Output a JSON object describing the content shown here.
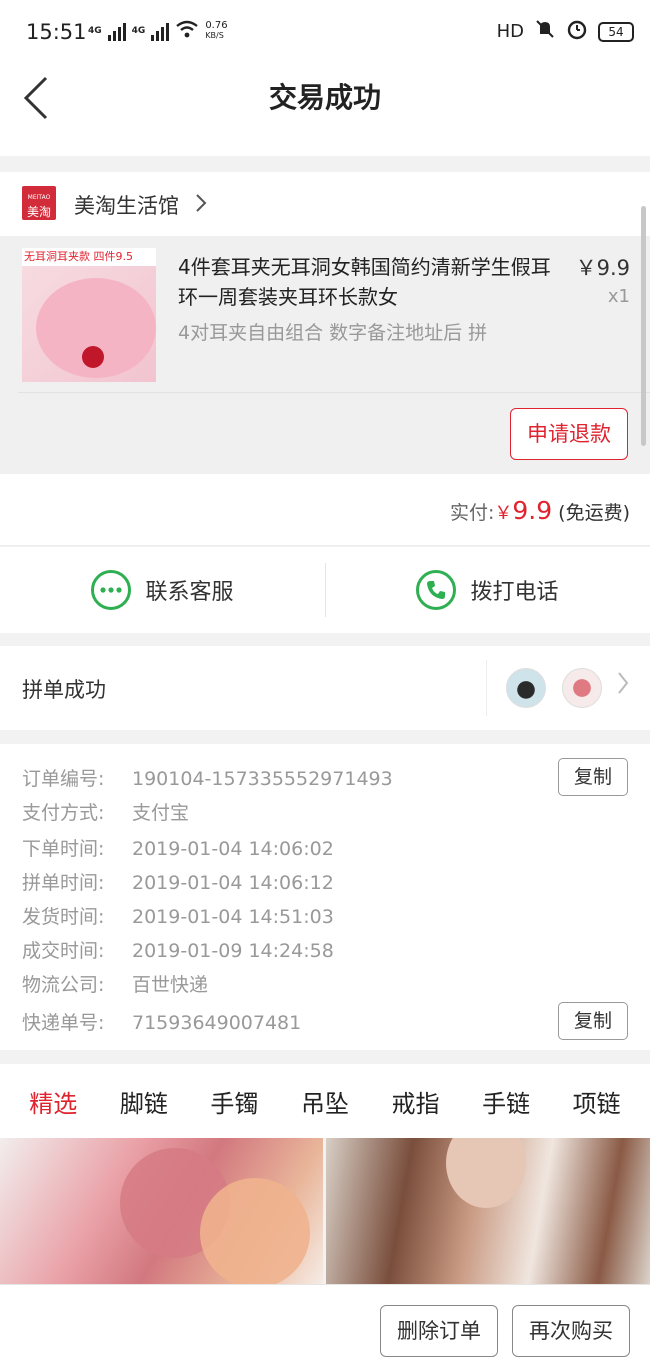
{
  "status_bar": {
    "time": "15:51",
    "net_1": "4G",
    "net_2": "4G",
    "speed": "0.76",
    "speed_unit": "KB/S",
    "hd": "HD",
    "battery": "54"
  },
  "nav": {
    "title": "交易成功"
  },
  "shop": {
    "logo_text_top": "MEITAO",
    "logo_text_bottom": "美淘",
    "name": "美淘生活馆"
  },
  "product": {
    "thumb_banner": "无耳洞耳夹款 四件9.5",
    "title": "4件套耳夹无耳洞女韩国简约清新学生假耳环一周套装夹耳环长款女",
    "spec": "4对耳夹自由组合 数字备注地址后 拼",
    "price": "￥9.9",
    "qty": "x1",
    "refund_label": "申请退款"
  },
  "payment": {
    "label": "实付:",
    "yen": "￥",
    "amount": "9.9",
    "note": "(免运费)"
  },
  "contact": {
    "service_label": "联系客服",
    "call_label": "拨打电话"
  },
  "group": {
    "label": "拼单成功"
  },
  "order_info": {
    "copy_label": "复制",
    "rows": [
      {
        "key": "订单编号:",
        "value": "190104-157335552971493"
      },
      {
        "key": "支付方式:",
        "value": "支付宝"
      },
      {
        "key": "下单时间:",
        "value": "2019-01-04 14:06:02"
      },
      {
        "key": "拼单时间:",
        "value": "2019-01-04 14:06:12"
      },
      {
        "key": "发货时间:",
        "value": "2019-01-04 14:51:03"
      },
      {
        "key": "成交时间:",
        "value": "2019-01-09 14:24:58"
      },
      {
        "key": "物流公司:",
        "value": "百世快递"
      },
      {
        "key": "快递单号:",
        "value": "71593649007481"
      }
    ]
  },
  "categories": [
    "精选",
    "脚链",
    "手镯",
    "吊坠",
    "戒指",
    "手链",
    "项链"
  ],
  "bottom": {
    "delete_label": "删除订单",
    "rebuy_label": "再次购买"
  },
  "colors": {
    "accent": "#e0242f",
    "green": "#2eaf52"
  }
}
